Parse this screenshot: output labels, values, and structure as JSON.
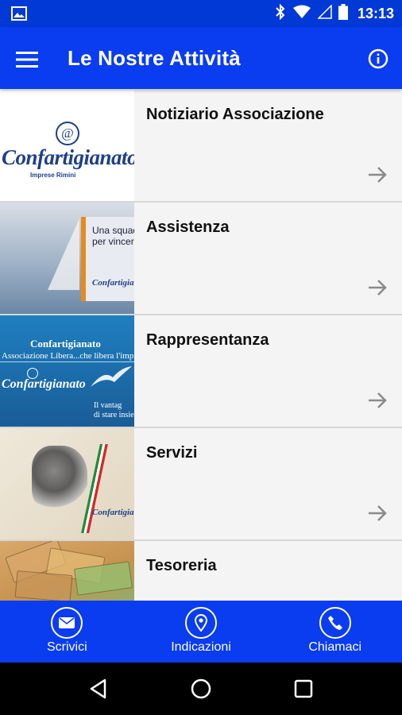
{
  "status_bar": {
    "time": "13:13",
    "icons": [
      "gallery-icon",
      "bluetooth-icon",
      "wifi-icon",
      "signal-icon",
      "battery-icon"
    ]
  },
  "app_bar": {
    "title": "Le Nostre Attività",
    "menu_icon": "hamburger-menu-icon",
    "info_icon": "info-icon"
  },
  "colors": {
    "primary": "#0a3cf0",
    "status_bar": "#0039d6",
    "list_background": "#f4f4f4",
    "arrow": "#8a8a8a"
  },
  "activities": [
    {
      "title": "Notiziario Associazione",
      "thumb_text": {
        "brand": "Confartigianato",
        "sub": "Imprese   Rimini",
        "mark": "@"
      }
    },
    {
      "title": "Assistenza",
      "thumb_text": {
        "slogan_1": "Una squad",
        "slogan_2": "per vincere",
        "brand": "Confartigianato"
      }
    },
    {
      "title": "Rappresentanza",
      "thumb_text": {
        "top": "Confartigianato",
        "mid": "Associazione Libera...che libera l'impresa",
        "brand": "Confartigianato",
        "small_1": "Il vantag",
        "small_2": "di stare insie"
      }
    },
    {
      "title": "Servizi",
      "thumb_text": {
        "brand": "Confartigianato"
      }
    },
    {
      "title": "Tesoreria",
      "thumb_text": {}
    }
  ],
  "action_bar": {
    "write_label": "Scrivici",
    "directions_label": "Indicazioni",
    "call_label": "Chiamaci"
  }
}
